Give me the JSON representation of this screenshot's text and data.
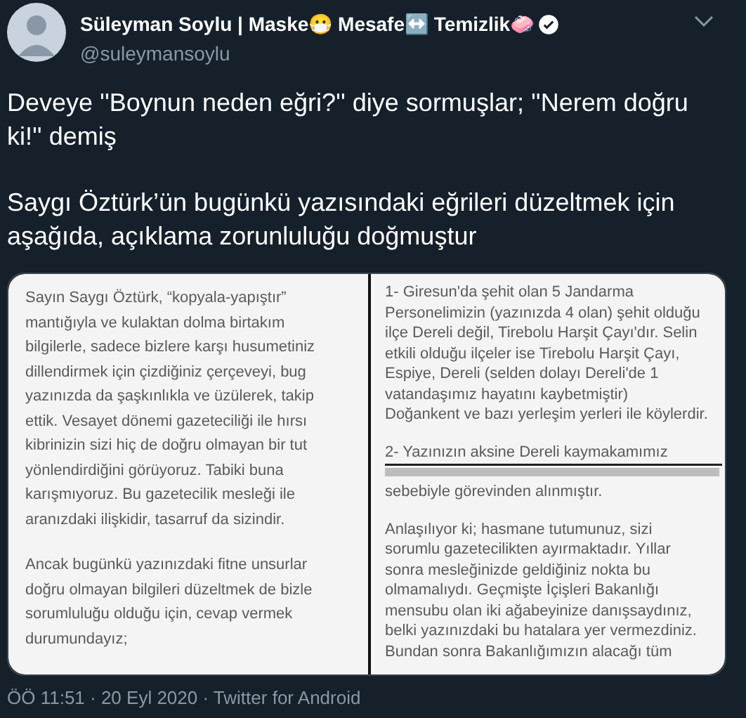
{
  "author": {
    "name": "Süleyman Soylu | Maske😷 Mesafe↔️ Temizlik🧼",
    "verified": true,
    "handle": "@suleymansoylu"
  },
  "tweet": {
    "paragraphs": [
      "Deveye ''Boynun neden eğri?'' diye sormuşlar; ''Nerem doğru ki!'' demiş",
      "Saygı Öztürk’ün bugünkü yazısındaki eğrileri düzeltmek için aşağıda, açıklama zorunluluğu doğmuştur"
    ]
  },
  "attached_image": {
    "panels": [
      {
        "paragraphs": [
          {
            "lines": [
              "Sayın Saygı Öztürk, “kopyala-yapıştır”",
              "mantığıyla ve kulaktan dolma birtakım",
              "bilgilerle, sadece bizlere karşı husumetiniz",
              "dillendirmek için çizdiğiniz çerçeveyi, bug",
              "yazınızda da şaşkınlıkla ve üzülerek, takip",
              "ettik. Vesayet dönemi gazeteciliği ile hırsı",
              "kibrinizin sizi hiç de doğru olmayan bir tut",
              "yönlendirdiğini görüyoruz. Tabiki buna",
              "karışmıyoruz. Bu gazetecilik mesleği ile",
              "aranızdaki ilişkidir, tasarruf da sizindir."
            ]
          },
          {
            "lines": [
              "Ancak bugünkü yazınızdaki fitne unsurlar",
              "doğru olmayan bilgileri düzeltmek de bizle",
              "sorumluluğu olduğu için, cevap vermek",
              "durumundayız;"
            ]
          }
        ]
      },
      {
        "paragraphs": [
          {
            "lines": [
              "1- Giresun'da şehit olan  5 Jandarma",
              "Personelimizin (yazınızda 4 olan) şehit olduğu",
              "ilçe Dereli değil, Tirebolu Harşit Çayı'dır. Selin",
              "etkili olduğu ilçeler ise Tirebolu Harşit Çayı,",
              "Espiye, Dereli (selden dolayı Dereli'de 1",
              "vatandaşımız hayatını kaybetmiştir)",
              "Doğankent ve bazı yerleşim yerleri ile köylerdir."
            ]
          },
          {
            "lines": [
              "2- Yazınızın aksine Dereli kaymakamımız"
            ],
            "struck_line": true,
            "after": [
              "sebebiyle görevinden alınmıştır."
            ]
          },
          {
            "lines": [
              "Anlaşılıyor ki; hasmane tutumunuz, sizi",
              "sorumlu gazetecilikten ayırmaktadır. Yıllar",
              "sonra  mesleğinizde geldiğiniz nokta bu",
              "olmamalıydı. Geçmişte İçişleri Bakanlığı",
              "mensubu olan iki ağabeyinize danışsaydınız,",
              "belki yazınızdaki bu hatalara yer vermezdiniz.",
              "Bundan sonra Bakanlığımızın alacağı tüm"
            ]
          }
        ]
      }
    ]
  },
  "footer": "ÖÖ 11:51 · 20 Eyl 2020 · Twitter for Android"
}
